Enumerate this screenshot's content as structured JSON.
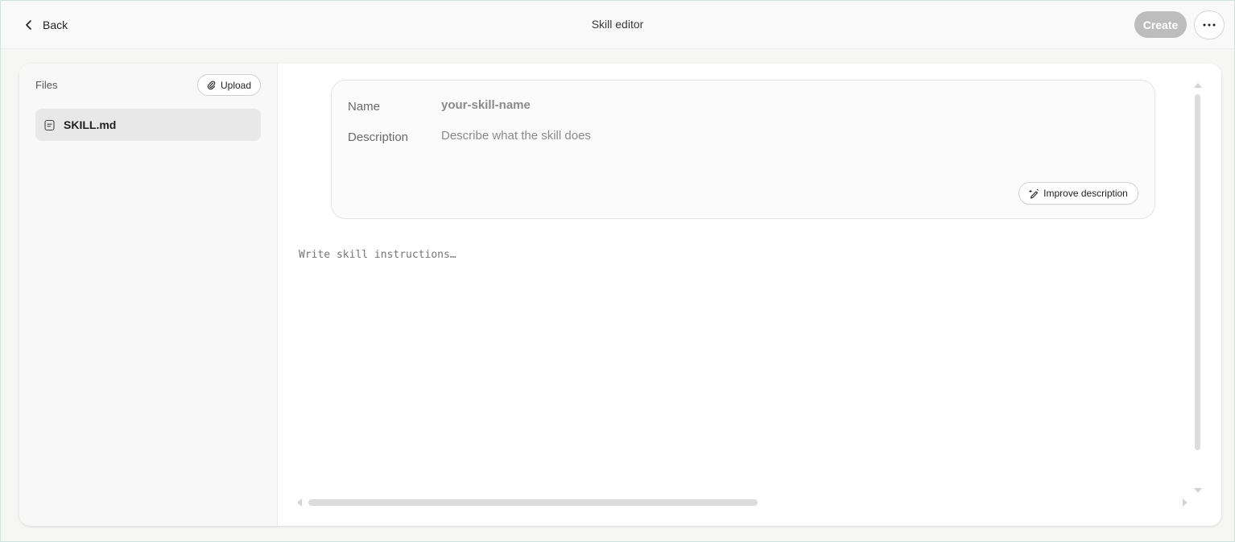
{
  "header": {
    "back_label": "Back",
    "title": "Skill editor",
    "create_label": "Create",
    "more_icon": "ellipsis-icon"
  },
  "sidebar": {
    "files_label": "Files",
    "upload_label": "Upload",
    "upload_icon": "paperclip-icon",
    "files": [
      {
        "name": "SKILL.md",
        "icon": "document-icon",
        "selected": true
      }
    ]
  },
  "meta": {
    "name_label": "Name",
    "name_value": "your-skill-name",
    "description_label": "Description",
    "description_placeholder": "Describe what the skill does",
    "improve_label": "Improve description",
    "improve_icon": "magic-pen-icon"
  },
  "editor": {
    "placeholder": "Write skill instructions…"
  },
  "colors": {
    "create_disabled_bg": "#bdbdbd",
    "selected_file_bg": "#e8e8e8",
    "window_border": "#cfe2dd"
  }
}
